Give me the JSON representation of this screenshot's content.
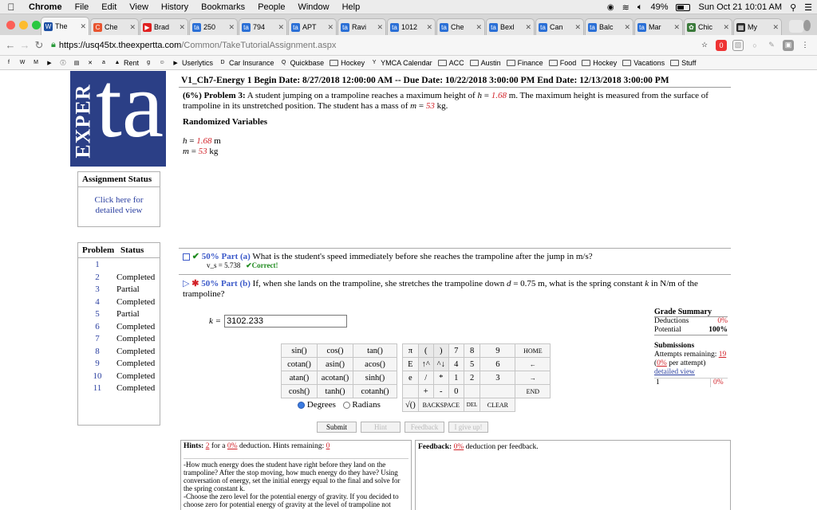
{
  "menubar": {
    "app": "Chrome",
    "items": [
      "File",
      "Edit",
      "View",
      "History",
      "Bookmarks",
      "People",
      "Window",
      "Help"
    ],
    "battery": "49%",
    "clock": "Sun Oct 21  10:01 AM"
  },
  "tabs": [
    {
      "label": "The",
      "color": "#1c4fa3",
      "glyph": "W"
    },
    {
      "label": "Che",
      "color": "#e8542f",
      "glyph": "C"
    },
    {
      "label": "Brad",
      "color": "#e02020",
      "glyph": "▶"
    },
    {
      "label": "250",
      "color": "#2a6fd6",
      "glyph": "ta"
    },
    {
      "label": "794",
      "color": "#2a6fd6",
      "glyph": "ta"
    },
    {
      "label": "APT",
      "color": "#2a6fd6",
      "glyph": "ta"
    },
    {
      "label": "Ravi",
      "color": "#2a6fd6",
      "glyph": "ta"
    },
    {
      "label": "1012",
      "color": "#2a6fd6",
      "glyph": "ta"
    },
    {
      "label": "Che",
      "color": "#2a6fd6",
      "glyph": "ta"
    },
    {
      "label": "Bexl",
      "color": "#2a6fd6",
      "glyph": "ta"
    },
    {
      "label": "Can",
      "color": "#2a6fd6",
      "glyph": "ta"
    },
    {
      "label": "Balc",
      "color": "#2a6fd6",
      "glyph": "ta"
    },
    {
      "label": "Mar",
      "color": "#2a6fd6",
      "glyph": "ta"
    },
    {
      "label": "Chic",
      "color": "#3a7a3a",
      "glyph": "✿"
    },
    {
      "label": "My",
      "color": "#2b2b2b",
      "glyph": "▦"
    }
  ],
  "address": {
    "host": "https://usq45tx.theexpertta.com",
    "path": "/Common/TakeTutorialAssignment.aspx"
  },
  "bookmarks": [
    {
      "label": "",
      "icon": "f"
    },
    {
      "label": "",
      "icon": "W"
    },
    {
      "label": "",
      "icon": "M"
    },
    {
      "label": "",
      "icon": "▶"
    },
    {
      "label": "",
      "icon": "ⓘ"
    },
    {
      "label": "",
      "icon": "▤"
    },
    {
      "label": "",
      "icon": "✕"
    },
    {
      "label": "",
      "icon": "a"
    },
    {
      "label": "Rent",
      "icon": "▲"
    },
    {
      "label": "",
      "icon": "g"
    },
    {
      "label": "",
      "icon": "☺"
    },
    {
      "label": "Userlytics",
      "icon": "▶"
    },
    {
      "label": "Car Insurance",
      "icon": "D"
    },
    {
      "label": "Quickbase",
      "icon": "Q"
    },
    {
      "label": "Hockey",
      "icon": "folder"
    },
    {
      "label": "YMCA Calendar",
      "icon": "Y"
    },
    {
      "label": "ACC",
      "icon": "folder"
    },
    {
      "label": "Austin",
      "icon": "folder"
    },
    {
      "label": "Finance",
      "icon": "folder"
    },
    {
      "label": "Food",
      "icon": "folder"
    },
    {
      "label": "Hockey",
      "icon": "folder"
    },
    {
      "label": "Vacations",
      "icon": "folder"
    },
    {
      "label": "Stuff",
      "icon": "folder"
    }
  ],
  "logo": {
    "exper": "EXPER",
    "ta": "ta"
  },
  "sidebar": {
    "assignment_status": "Assignment Status",
    "status_link": "Click here for detailed view",
    "problem_header": "Problem",
    "status_header": "Status",
    "problems": [
      {
        "num": "1",
        "status": ""
      },
      {
        "num": "2",
        "status": "Completed"
      },
      {
        "num": "3",
        "status": "Partial"
      },
      {
        "num": "4",
        "status": "Completed"
      },
      {
        "num": "5",
        "status": "Partial"
      },
      {
        "num": "6",
        "status": "Completed"
      },
      {
        "num": "7",
        "status": "Completed"
      },
      {
        "num": "8",
        "status": "Completed"
      },
      {
        "num": "9",
        "status": "Completed"
      },
      {
        "num": "10",
        "status": "Completed"
      },
      {
        "num": "11",
        "status": "Completed"
      }
    ]
  },
  "assignment": {
    "title": "V1_Ch7-Energy 1 Begin Date: 8/27/2018 12:00:00 AM -- Due Date: 10/22/2018 3:00:00 PM End Date: 12/13/2018 3:00:00 PM"
  },
  "problem": {
    "weight": "(6%)",
    "label": "Problem 3:",
    "text_a": " A student jumping on a trampoline reaches a maximum height of ",
    "h_var": "h",
    "h_eq": " = ",
    "h_val": "1.68",
    "text_b": " m. The maximum height is measured from the surface of trampoline in its unstretched position. The student has a mass of ",
    "m_var": "m",
    "m_eq": " = ",
    "m_val": "53",
    "text_c": " kg."
  },
  "randomized": {
    "header": "Randomized Variables",
    "h_name": "h",
    "h_eq": " = ",
    "h_val": "1.68",
    "h_unit": " m",
    "m_name": "m",
    "m_eq": " = ",
    "m_val": "53",
    "m_unit": " kg"
  },
  "partA": {
    "percent": "50% Part (a)",
    "question": "What is the student's speed immediately before she reaches the trampoline after the jump in m/s?",
    "answer": "v_s = 5.738",
    "correct": "Correct!"
  },
  "partB": {
    "percent": "50% Part (b)",
    "question_a": "If, when she lands on the trampoline, she stretches the trampoline down ",
    "d_var": "d",
    "question_b": " = 0.75 m, what is the spring constant ",
    "k_var": "k",
    "question_c": " in N/m of the trampoline?",
    "input_label": "k =",
    "input_value": "3102.233"
  },
  "calculator": {
    "funcs": [
      [
        "sin()",
        "cos()",
        "tan()"
      ],
      [
        "cotan()",
        "asin()",
        "acos()"
      ],
      [
        "atan()",
        "acotan()",
        "sinh()"
      ],
      [
        "cosh()",
        "tanh()",
        "cotanh()"
      ]
    ],
    "keys": [
      [
        "π",
        "(",
        ")",
        "7",
        "8",
        "9",
        "HOME"
      ],
      [
        "E",
        "↑^",
        "^↓",
        "4",
        "5",
        "6",
        "←"
      ],
      [
        "e",
        "/",
        "*",
        "1",
        "2",
        "3",
        "→"
      ],
      [
        "",
        "+",
        "-",
        "0",
        "",
        "",
        "END"
      ]
    ],
    "bottom": [
      "√()",
      "BACKSPACE",
      "DEL",
      "CLEAR"
    ],
    "degrees": "Degrees",
    "radians": "Radians"
  },
  "grade": {
    "header": "Grade Summary",
    "deductions_label": "Deductions",
    "deductions_val": "0%",
    "potential_label": "Potential",
    "potential_val": "100%",
    "submissions_label": "Submissions",
    "attempts_label": "Attempts remaining: ",
    "attempts_val": "19",
    "per_attempt_pct": "0%",
    "per_attempt_text": " per attempt)",
    "detailed": "detailed view",
    "row_num": "1",
    "row_pct": "0%"
  },
  "buttons": [
    "Submit",
    "Hint",
    "Feedback",
    "I give up!"
  ],
  "hints": {
    "label": "Hints:",
    "count": "2",
    "for_a": " for a ",
    "pct": "0%",
    "deduction": " deduction. Hints remaining: ",
    "remaining": "0",
    "hint1": "-How much energy does the student have right before they land on the trampoline? After the stop moving, how much energy do they have? Using conversation of energy, set the initial energy equal to the final and solve for the spring constant k.",
    "hint2": "-Choose the zero level for the potential energy of gravity. If you decided to choose zero for potential energy of gravity at the level of trampoline not"
  },
  "feedback": {
    "label": "Feedback:",
    "pct": "0%",
    "text": " deduction per feedback."
  }
}
